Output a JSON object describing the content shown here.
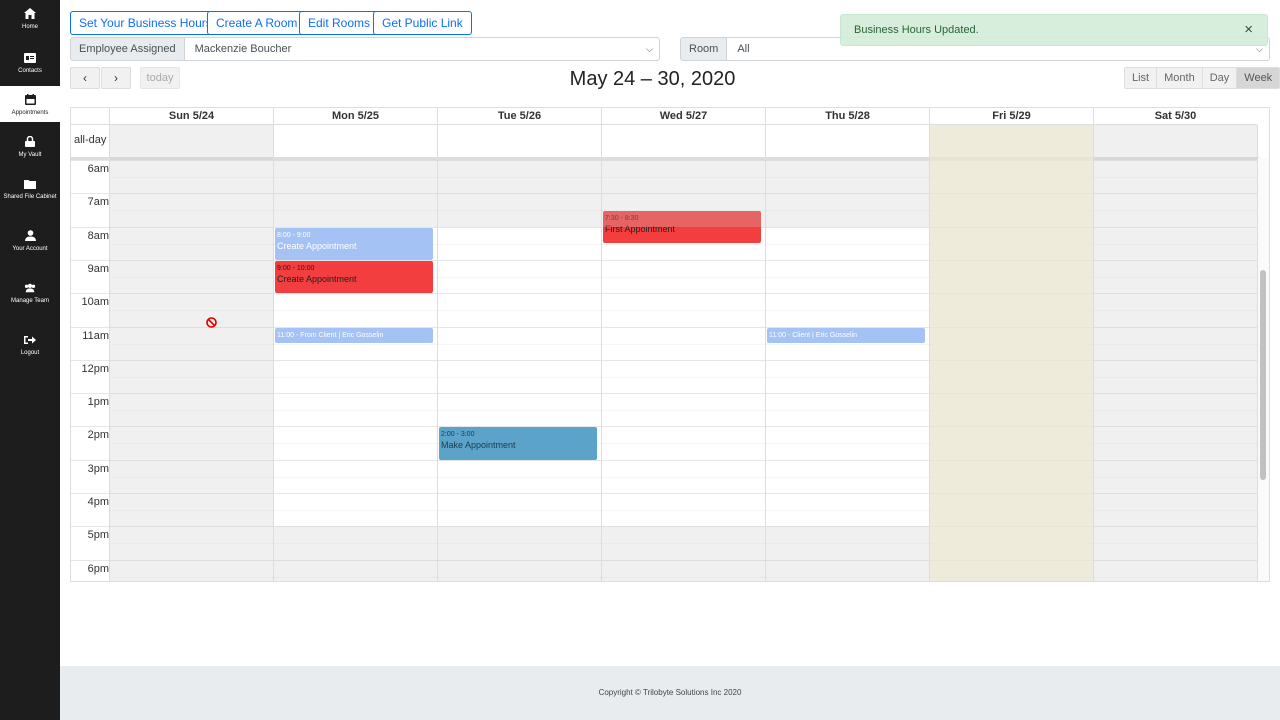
{
  "sidebar": {
    "items": [
      {
        "label": "Home",
        "icon": "home-icon"
      },
      {
        "label": "Contacts",
        "icon": "contacts-icon"
      },
      {
        "label": "Appointments",
        "icon": "calendar-icon",
        "active": true
      },
      {
        "label": "My Vault",
        "icon": "lock-icon"
      },
      {
        "label": "Shared File Cabinet",
        "icon": "folder-icon"
      },
      {
        "label": "Your Account",
        "icon": "user-icon"
      },
      {
        "label": "Manage Team",
        "icon": "team-icon"
      },
      {
        "label": "Logout",
        "icon": "logout-icon"
      }
    ]
  },
  "toolbar": {
    "business_hours": "Set Your Business Hours",
    "create_room": "Create A Room",
    "edit_rooms": "Edit Rooms",
    "public_link": "Get Public Link"
  },
  "filters": {
    "employee_label": "Employee Assigned",
    "employee_value": "Mackenzie Boucher",
    "room_label": "Room",
    "room_value": "All"
  },
  "toast": {
    "message": "Business Hours Updated.",
    "close": "×"
  },
  "calendar": {
    "title": "May 24 – 30, 2020",
    "today_label": "today",
    "prev": "‹",
    "next": "›",
    "views": [
      "List",
      "Month",
      "Day",
      "Week"
    ],
    "active_view": "Week",
    "days": [
      "Sun 5/24",
      "Mon 5/25",
      "Tue 5/26",
      "Wed 5/27",
      "Thu 5/28",
      "Fri 5/29",
      "Sat 5/30"
    ],
    "allday_label": "all-day",
    "times": [
      "6am",
      "7am",
      "8am",
      "9am",
      "10am",
      "11am",
      "12pm",
      "1pm",
      "2pm",
      "3pm",
      "4pm",
      "5pm",
      "6pm"
    ],
    "events": [
      {
        "day": 1,
        "start": 8.0,
        "end": 9.0,
        "time": "8:00 - 9:00",
        "name": "Create Appointment",
        "color": "#a4c2f4",
        "text": "#ffffff"
      },
      {
        "day": 1,
        "start": 9.0,
        "end": 10.0,
        "time": "9:00 - 10:00",
        "name": "Create Appointment",
        "color": "#f23e3e",
        "text": "#222222"
      },
      {
        "day": 1,
        "start": 11.0,
        "end": 11.5,
        "time": "11:00 - From Client | Eric Gosselin",
        "name": "",
        "color": "#a4c2f4",
        "text": "#ffffff"
      },
      {
        "day": 3,
        "start": 7.5,
        "end": 8.5,
        "time": "7:30 - 8:30",
        "name": "First Appointment",
        "color": "#f23e3e",
        "text": "#222222"
      },
      {
        "day": 4,
        "start": 11.0,
        "end": 11.5,
        "time": "11:00 - Client | Eric Gosselin",
        "name": "",
        "color": "#a4c2f4",
        "text": "#ffffff"
      },
      {
        "day": 2,
        "start": 14.0,
        "end": 15.0,
        "time": "2:00 - 3:00",
        "name": "Make Appointment",
        "color": "#5ba3c8",
        "text": "#1d3b4a"
      }
    ]
  },
  "footer": {
    "text": "Copyright © Trilobyte Solutions Inc 2020"
  }
}
